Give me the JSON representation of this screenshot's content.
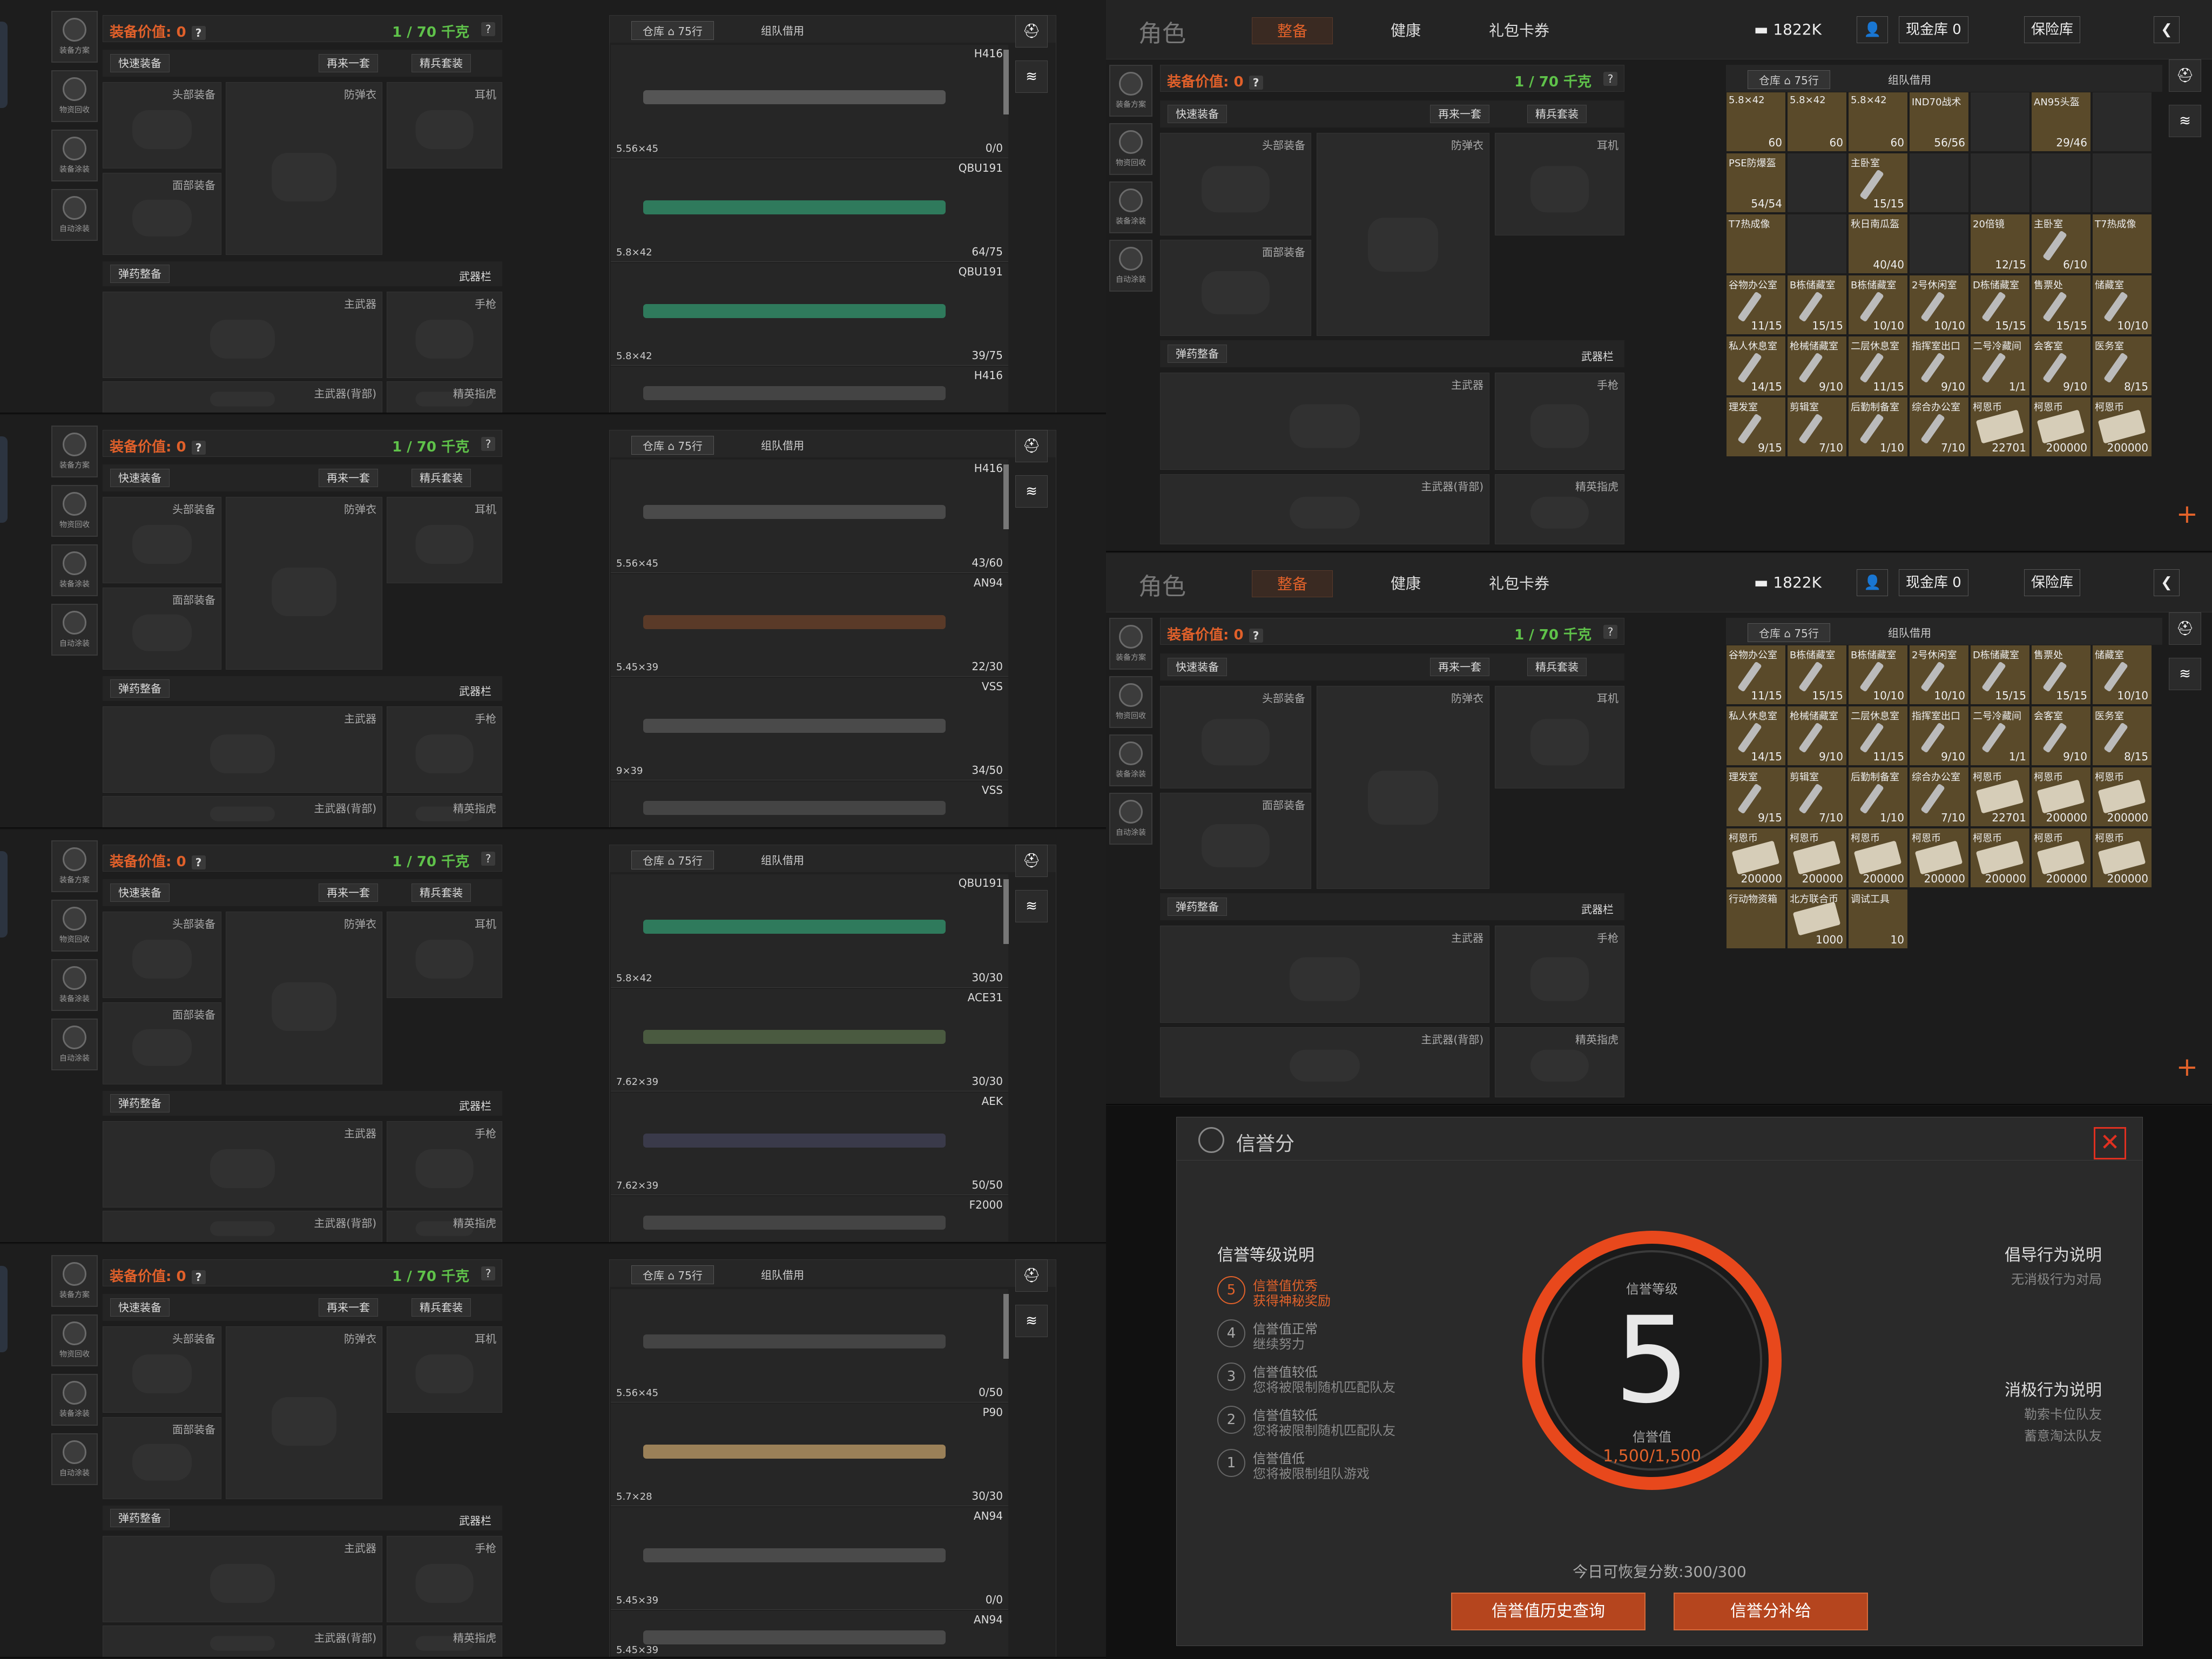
{
  "common": {
    "equip_value": "装备价值: 0",
    "weight": "1 / 70 千克",
    "help": "?",
    "quick_equip": "快速装备",
    "again": "再来一套",
    "elite": "精兵套装",
    "head": "头部装备",
    "armor": "防弹衣",
    "ear": "耳机",
    "face": "面部装备",
    "ammo": "弹药整备",
    "weapon_bar": "武器栏",
    "main": "主武器",
    "pistol": "手枪",
    "main_back": "主武器(背部)",
    "elite_ring": "精英指虎",
    "side": [
      "装备方案",
      "物资回收",
      "装备涂装",
      "自动涂装"
    ],
    "wh_tab1": "仓库 ⌂ 75行",
    "wh_tab2": "组队借用"
  },
  "panels": [
    {
      "weapons": [
        {
          "name": "H416",
          "cal": "5.56×45",
          "count": "0/0",
          "color": "#555"
        },
        {
          "name": "QBU191",
          "cal": "5.8×42",
          "count": "64/75",
          "color": "#2f7a5c"
        },
        {
          "name": "QBU191",
          "cal": "5.8×42",
          "count": "39/75",
          "color": "#2f7a5c"
        },
        {
          "name": "H416",
          "cal": "",
          "count": "",
          "color": "#444"
        }
      ]
    },
    {
      "weapons": [
        {
          "name": "H416",
          "cal": "5.56×45",
          "count": "43/60",
          "color": "#4a4a4a"
        },
        {
          "name": "AN94",
          "cal": "5.45×39",
          "count": "22/30",
          "color": "#5a3a28"
        },
        {
          "name": "VSS",
          "cal": "9×39",
          "count": "34/50",
          "color": "#4a4a4a"
        },
        {
          "name": "VSS",
          "cal": "",
          "count": "",
          "color": "#444"
        }
      ]
    },
    {
      "weapons": [
        {
          "name": "QBU191",
          "cal": "5.8×42",
          "count": "30/30",
          "color": "#2f7a5c"
        },
        {
          "name": "ACE31",
          "cal": "7.62×39",
          "count": "30/30",
          "color": "#4a5a40"
        },
        {
          "name": "AEK",
          "cal": "7.62×39",
          "count": "50/50",
          "color": "#3a3a4a"
        },
        {
          "name": "F2000",
          "cal": "",
          "count": "",
          "color": "#444"
        }
      ]
    },
    {
      "weapons": [
        {
          "name": "",
          "cal": "5.56×45",
          "count": "0/50",
          "color": "#444"
        },
        {
          "name": "P90",
          "cal": "5.7×28",
          "count": "30/30",
          "color": "#9a8058"
        },
        {
          "name": "AN94",
          "cal": "5.45×39",
          "count": "0/0",
          "color": "#4a4a4a"
        },
        {
          "name": "AN94",
          "cal": "5.45×39",
          "count": "",
          "color": "#4a4a4a"
        }
      ]
    }
  ],
  "right": {
    "title": "角色",
    "tabs": [
      "整备",
      "健康",
      "礼包卡券"
    ],
    "money": "1822K",
    "cash": "现金库 0",
    "safe": "保险库",
    "grid_top": [
      {
        "n": "5.8×42",
        "c": "60"
      },
      {
        "n": "5.8×42",
        "c": "60"
      },
      {
        "n": "5.8×42",
        "c": "60"
      },
      {
        "n": "IND70战术",
        "c": "56/56"
      },
      {
        "n": "",
        "c": ""
      },
      {
        "n": "AN95头盔",
        "c": "29/46"
      },
      {
        "n": "",
        "c": ""
      },
      {
        "n": "PSE防爆盔",
        "c": "54/54"
      },
      {
        "n": "",
        "c": ""
      },
      {
        "n": "主卧室",
        "c": "15/15"
      },
      {
        "n": "",
        "c": ""
      },
      {
        "n": "",
        "c": ""
      },
      {
        "n": "",
        "c": ""
      },
      {
        "n": "",
        "c": ""
      },
      {
        "n": "T7热成像",
        "c": ""
      },
      {
        "n": "",
        "c": ""
      },
      {
        "n": "秋日南瓜盔",
        "c": "40/40"
      },
      {
        "n": "",
        "c": ""
      },
      {
        "n": "20倍镜",
        "c": "12/15"
      },
      {
        "n": "主卧室",
        "c": "6/10"
      },
      {
        "n": "T7热成像",
        "c": ""
      },
      {
        "n": "谷物办公室",
        "c": "11/15"
      },
      {
        "n": "B栋储藏室",
        "c": "15/15"
      },
      {
        "n": "B栋储藏室",
        "c": "10/10"
      },
      {
        "n": "2号休闲室",
        "c": "10/10"
      },
      {
        "n": "D栋储藏室",
        "c": "15/15"
      },
      {
        "n": "售票处",
        "c": "15/15"
      },
      {
        "n": "储藏室",
        "c": "10/10"
      },
      {
        "n": "私人休息室",
        "c": "14/15"
      },
      {
        "n": "枪械储藏室",
        "c": "9/10"
      },
      {
        "n": "二层休息室",
        "c": "11/15"
      },
      {
        "n": "指挥室出口",
        "c": "9/10"
      },
      {
        "n": "二号冷藏间",
        "c": "1/1"
      },
      {
        "n": "会客室",
        "c": "9/10"
      },
      {
        "n": "医务室",
        "c": "8/15"
      },
      {
        "n": "理发室",
        "c": "9/15"
      },
      {
        "n": "剪辑室",
        "c": "7/10"
      },
      {
        "n": "后勤制备室",
        "c": "1/10"
      },
      {
        "n": "综合办公室",
        "c": "7/10"
      },
      {
        "n": "柯恩币",
        "c": "22701"
      },
      {
        "n": "柯恩币",
        "c": "200000"
      },
      {
        "n": "柯恩币",
        "c": "200000"
      }
    ],
    "grid_bottom": [
      {
        "n": "谷物办公室",
        "c": "11/15"
      },
      {
        "n": "B栋储藏室",
        "c": "15/15"
      },
      {
        "n": "B栋储藏室",
        "c": "10/10"
      },
      {
        "n": "2号休闲室",
        "c": "10/10"
      },
      {
        "n": "D栋储藏室",
        "c": "15/15"
      },
      {
        "n": "售票处",
        "c": "15/15"
      },
      {
        "n": "储藏室",
        "c": "10/10"
      },
      {
        "n": "私人休息室",
        "c": "14/15"
      },
      {
        "n": "枪械储藏室",
        "c": "9/10"
      },
      {
        "n": "二层休息室",
        "c": "11/15"
      },
      {
        "n": "指挥室出口",
        "c": "9/10"
      },
      {
        "n": "二号冷藏间",
        "c": "1/1"
      },
      {
        "n": "会客室",
        "c": "9/10"
      },
      {
        "n": "医务室",
        "c": "8/15"
      },
      {
        "n": "理发室",
        "c": "9/15"
      },
      {
        "n": "剪辑室",
        "c": "7/10"
      },
      {
        "n": "后勤制备室",
        "c": "1/10"
      },
      {
        "n": "综合办公室",
        "c": "7/10"
      },
      {
        "n": "柯恩币",
        "c": "22701"
      },
      {
        "n": "柯恩币",
        "c": "200000"
      },
      {
        "n": "柯恩币",
        "c": "200000"
      },
      {
        "n": "柯恩币",
        "c": "200000"
      },
      {
        "n": "柯恩币",
        "c": "200000"
      },
      {
        "n": "柯恩币",
        "c": "200000"
      },
      {
        "n": "柯恩币",
        "c": "200000"
      },
      {
        "n": "柯恩币",
        "c": "200000"
      },
      {
        "n": "柯恩币",
        "c": "200000"
      },
      {
        "n": "柯恩币",
        "c": "200000"
      },
      {
        "n": "行动物资箱",
        "c": ""
      },
      {
        "n": "北方联合币",
        "c": "1000"
      },
      {
        "n": "调试工具",
        "c": "10"
      }
    ]
  },
  "modal": {
    "title": "信誉分",
    "levels_title": "信誉等级说明",
    "levels": [
      {
        "n": "5",
        "a": "信誉值优秀",
        "b": "获得神秘奖励"
      },
      {
        "n": "4",
        "a": "信誉值正常",
        "b": "继续努力"
      },
      {
        "n": "3",
        "a": "信誉值较低",
        "b": "您将被限制随机匹配队友"
      },
      {
        "n": "2",
        "a": "信誉值较低",
        "b": "您将被限制随机匹配队友"
      },
      {
        "n": "1",
        "a": "信誉值低",
        "b": "您将被限制组队游戏"
      }
    ],
    "ring_top": "信誉等级",
    "ring_level": "5",
    "ring_sub": "信誉值",
    "ring_score": "1,500/1,500",
    "pos_title": "倡导行为说明",
    "pos_text": "无消极行为对局",
    "neg_title": "消极行为说明",
    "neg_1": "勒索卡位队友",
    "neg_2": "蓄意淘汰队友",
    "recover": "今日可恢复分数:300/300",
    "btn_history": "信誉值历史查询",
    "btn_supply": "信誉分补给"
  }
}
